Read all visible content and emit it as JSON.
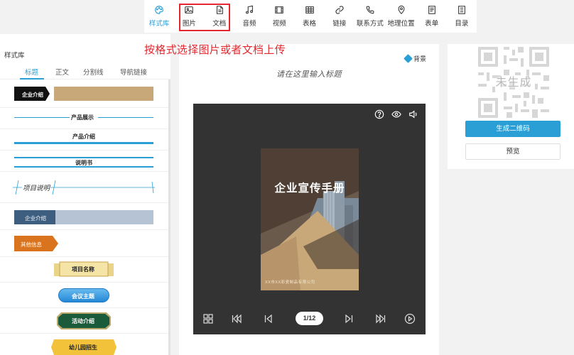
{
  "toolbar": {
    "items": [
      {
        "label": "样式库",
        "icon": "palette-icon"
      },
      {
        "label": "图片",
        "icon": "image-icon"
      },
      {
        "label": "文档",
        "icon": "document-icon"
      },
      {
        "label": "音频",
        "icon": "music-note-icon"
      },
      {
        "label": "视频",
        "icon": "film-icon"
      },
      {
        "label": "表格",
        "icon": "table-icon"
      },
      {
        "label": "链接",
        "icon": "link-icon"
      },
      {
        "label": "联系方式",
        "icon": "phone-icon"
      },
      {
        "label": "地理位置",
        "icon": "location-pin-icon"
      },
      {
        "label": "表单",
        "icon": "form-icon"
      },
      {
        "label": "目录",
        "icon": "catalog-icon"
      }
    ],
    "accent": "#2a9fd6"
  },
  "instruction": "按格式选择图片或者文档上传",
  "left_panel": {
    "title": "样式库",
    "tabs": [
      "标题",
      "正文",
      "分割线",
      "导航链接"
    ],
    "styles": [
      "企业介绍",
      "产品展示",
      "产品介绍",
      "说明书",
      "项目说明",
      "企业介绍",
      "其他信息",
      "项目名称",
      "会议主题",
      "活动介绍",
      "幼儿园招生"
    ]
  },
  "editor": {
    "background_label": "背景",
    "title_placeholder": "请在这里输入标题"
  },
  "viewer": {
    "doc_title": "企业宣传手册",
    "doc_company": "XX市XX彩瓷制品有限公司",
    "page_indicator": "1/12"
  },
  "right_panel": {
    "qr_label": "未生成",
    "generate_button": "生成二维码",
    "preview_button": "预览"
  },
  "colors": {
    "highlight": "#e4262d",
    "accent_blue": "#2a9fd6",
    "viewer_bg": "#333333",
    "tan": "#c8a878"
  }
}
